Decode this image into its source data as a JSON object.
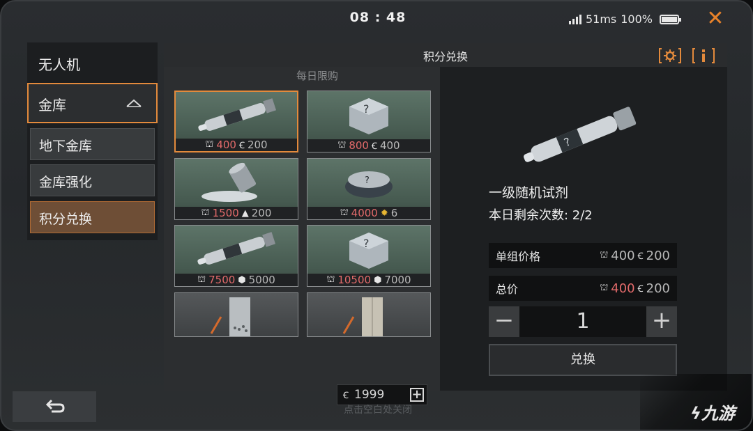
{
  "status": {
    "time": "08 : 48",
    "ping": "51ms",
    "battery": "100%"
  },
  "nav": {
    "header": "无人机",
    "group": "金库",
    "items": [
      {
        "label": "地下金库",
        "active": false
      },
      {
        "label": "金库强化",
        "active": false
      },
      {
        "label": "积分兑换",
        "active": true
      }
    ]
  },
  "panel": {
    "title": "积分兑换",
    "section": "每日限购",
    "items": [
      {
        "name": "syringe",
        "cost": "400",
        "alt_icon": "g-coin",
        "alt": "200",
        "selected": true
      },
      {
        "name": "mystery-box",
        "cost": "800",
        "alt_icon": "g-coin",
        "alt": "400"
      },
      {
        "name": "spilled-canister",
        "cost": "1500",
        "alt_icon": "ore",
        "alt": "200"
      },
      {
        "name": "mystery-disc",
        "cost": "4000",
        "alt_icon": "sun",
        "alt": "6"
      },
      {
        "name": "syringe",
        "cost": "7500",
        "alt_icon": "cube",
        "alt": "5000"
      },
      {
        "name": "mystery-box",
        "cost": "10500",
        "alt_icon": "cube",
        "alt": "7000"
      },
      {
        "name": "card-pen"
      },
      {
        "name": "card-pen"
      }
    ],
    "currency": "1999"
  },
  "detail": {
    "name": "一级随机试剂",
    "remaining": "本日剩余次数: 2/2",
    "unit_price_label": "单组价格",
    "unit_price": {
      "cost": "400",
      "alt": "200"
    },
    "total_label": "总价",
    "total": {
      "cost": "400",
      "alt": "200"
    },
    "quantity": "1",
    "exchange_label": "兑换"
  },
  "footer": {
    "hint": "点击空白处关闭",
    "watermark": "九游"
  },
  "colors": {
    "accent": "#e38a3c",
    "cost_red": "#e26a6a",
    "card_green": "#5d7468"
  }
}
